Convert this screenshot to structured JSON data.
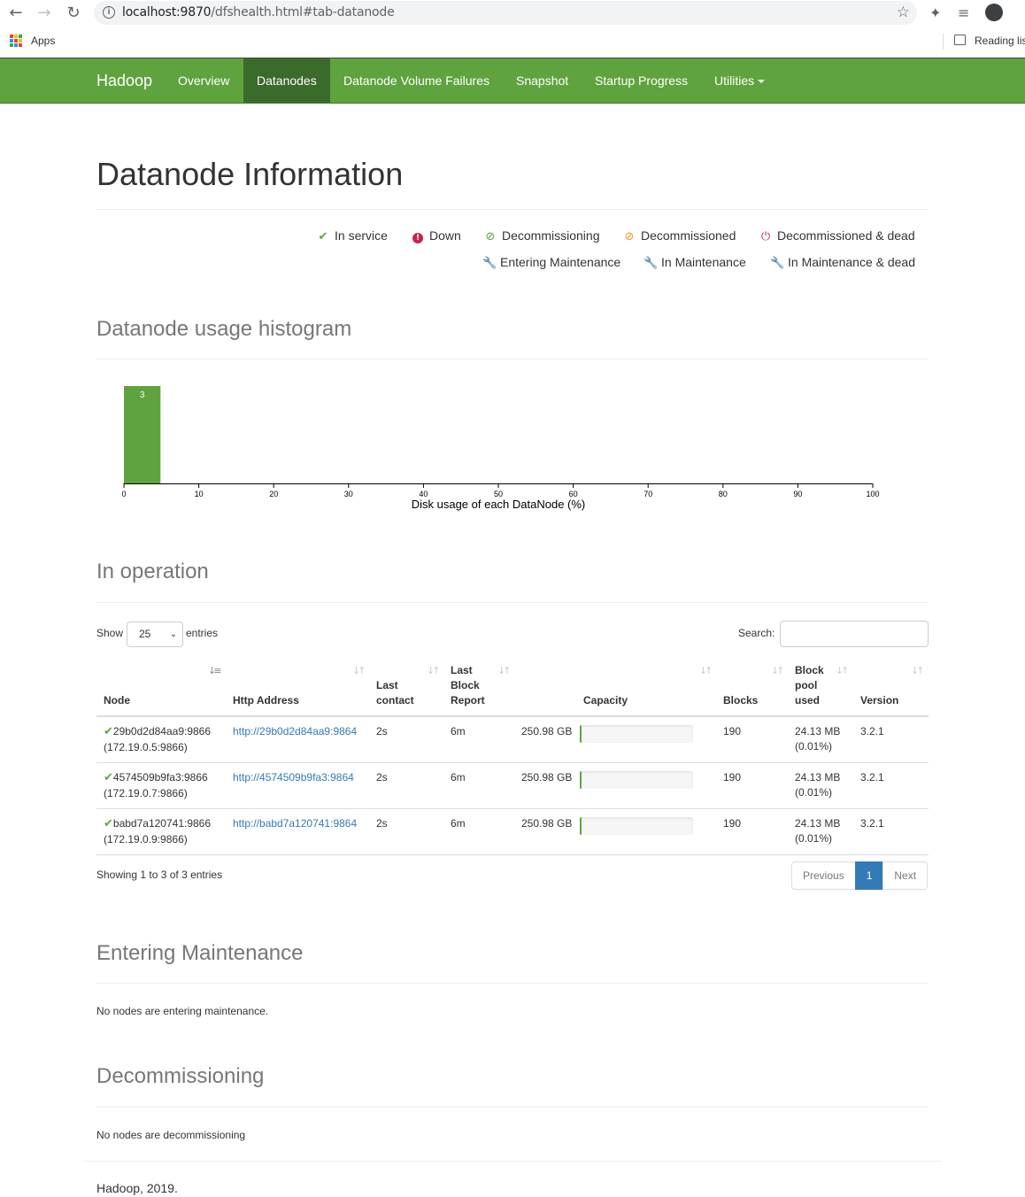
{
  "browser": {
    "url_host": "localhost:9870",
    "url_path": "/dfshealth.html#tab-datanode",
    "bookmarks": {
      "apps_label": "Apps",
      "reading_list_label": "Reading list"
    }
  },
  "navbar": {
    "brand": "Hadoop",
    "items": [
      {
        "label": "Overview",
        "active": false
      },
      {
        "label": "Datanodes",
        "active": true
      },
      {
        "label": "Datanode Volume Failures",
        "active": false
      },
      {
        "label": "Snapshot",
        "active": false
      },
      {
        "label": "Startup Progress",
        "active": false
      },
      {
        "label": "Utilities",
        "active": false,
        "dropdown": true
      }
    ]
  },
  "page_title": "Datanode Information",
  "legend": [
    {
      "label": "In service",
      "icon": "checkmark-icon",
      "color": "#5fa33e"
    },
    {
      "label": "Down",
      "icon": "alert-circle-icon",
      "color": "#c7254e"
    },
    {
      "label": "Decommissioning",
      "icon": "ban-circle-icon",
      "color": "#5fa33e"
    },
    {
      "label": "Decommissioned",
      "icon": "ban-circle-icon",
      "color": "#ec971f"
    },
    {
      "label": "Decommissioned & dead",
      "icon": "power-icon",
      "color": "#c7254e"
    },
    {
      "label": "Entering Maintenance",
      "icon": "wrench-icon",
      "color": "#5fa33e"
    },
    {
      "label": "In Maintenance",
      "icon": "wrench-icon",
      "color": "#ec971f"
    },
    {
      "label": "In Maintenance & dead",
      "icon": "wrench-icon",
      "color": "#c7254e"
    }
  ],
  "histogram": {
    "title": "Datanode usage histogram",
    "chart_data": {
      "type": "bar",
      "bins": [
        [
          0,
          5
        ]
      ],
      "counts": [
        3
      ],
      "data_labels": [
        "3"
      ],
      "xlabel": "Disk usage of each DataNode (%)",
      "xlim": [
        0,
        100
      ],
      "xticks": [
        0,
        10,
        20,
        30,
        40,
        50,
        60,
        70,
        80,
        90,
        100
      ],
      "bar_color": "#5fa33e"
    }
  },
  "in_operation": {
    "title": "In operation",
    "show_label": "Show",
    "page_size": "25",
    "entries_label": "entries",
    "search_label": "Search:",
    "search_value": "",
    "columns": [
      {
        "key": "node",
        "label": "Node"
      },
      {
        "key": "http",
        "label": "Http Address"
      },
      {
        "key": "last_contact",
        "label": "Last contact"
      },
      {
        "key": "last_block_report",
        "label": "Last Block Report"
      },
      {
        "key": "capacity",
        "label": "Capacity"
      },
      {
        "key": "blocks",
        "label": "Blocks"
      },
      {
        "key": "block_pool_used",
        "label": "Block pool used"
      },
      {
        "key": "version",
        "label": "Version"
      }
    ],
    "rows": [
      {
        "node": "29b0d2d84aa9:9866",
        "node_ip": "(172.19.0.5:9866)",
        "http": "http://29b0d2d84aa9:9864",
        "last_contact": "2s",
        "last_block_report": "6m",
        "capacity": "250.98 GB",
        "used_fraction": 0.0001,
        "blocks": "190",
        "bpu": "24.13 MB",
        "bpu_pct": "(0.01%)",
        "version": "3.2.1"
      },
      {
        "node": "4574509b9fa3:9866",
        "node_ip": "(172.19.0.7:9866)",
        "http": "http://4574509b9fa3:9864",
        "last_contact": "2s",
        "last_block_report": "6m",
        "capacity": "250.98 GB",
        "used_fraction": 0.0001,
        "blocks": "190",
        "bpu": "24.13 MB",
        "bpu_pct": "(0.01%)",
        "version": "3.2.1"
      },
      {
        "node": "babd7a120741:9866",
        "node_ip": "(172.19.0.9:9866)",
        "http": "http://babd7a120741:9864",
        "last_contact": "2s",
        "last_block_report": "6m",
        "capacity": "250.98 GB",
        "used_fraction": 0.0001,
        "blocks": "190",
        "bpu": "24.13 MB",
        "bpu_pct": "(0.01%)",
        "version": "3.2.1"
      }
    ],
    "info": "Showing 1 to 3 of 3 entries",
    "pagination": {
      "previous": "Previous",
      "current": "1",
      "next": "Next"
    }
  },
  "entering_maintenance": {
    "title": "Entering Maintenance",
    "message": "No nodes are entering maintenance."
  },
  "decommissioning": {
    "title": "Decommissioning",
    "message": "No nodes are decommissioning"
  },
  "footer": "Hadoop, 2019."
}
